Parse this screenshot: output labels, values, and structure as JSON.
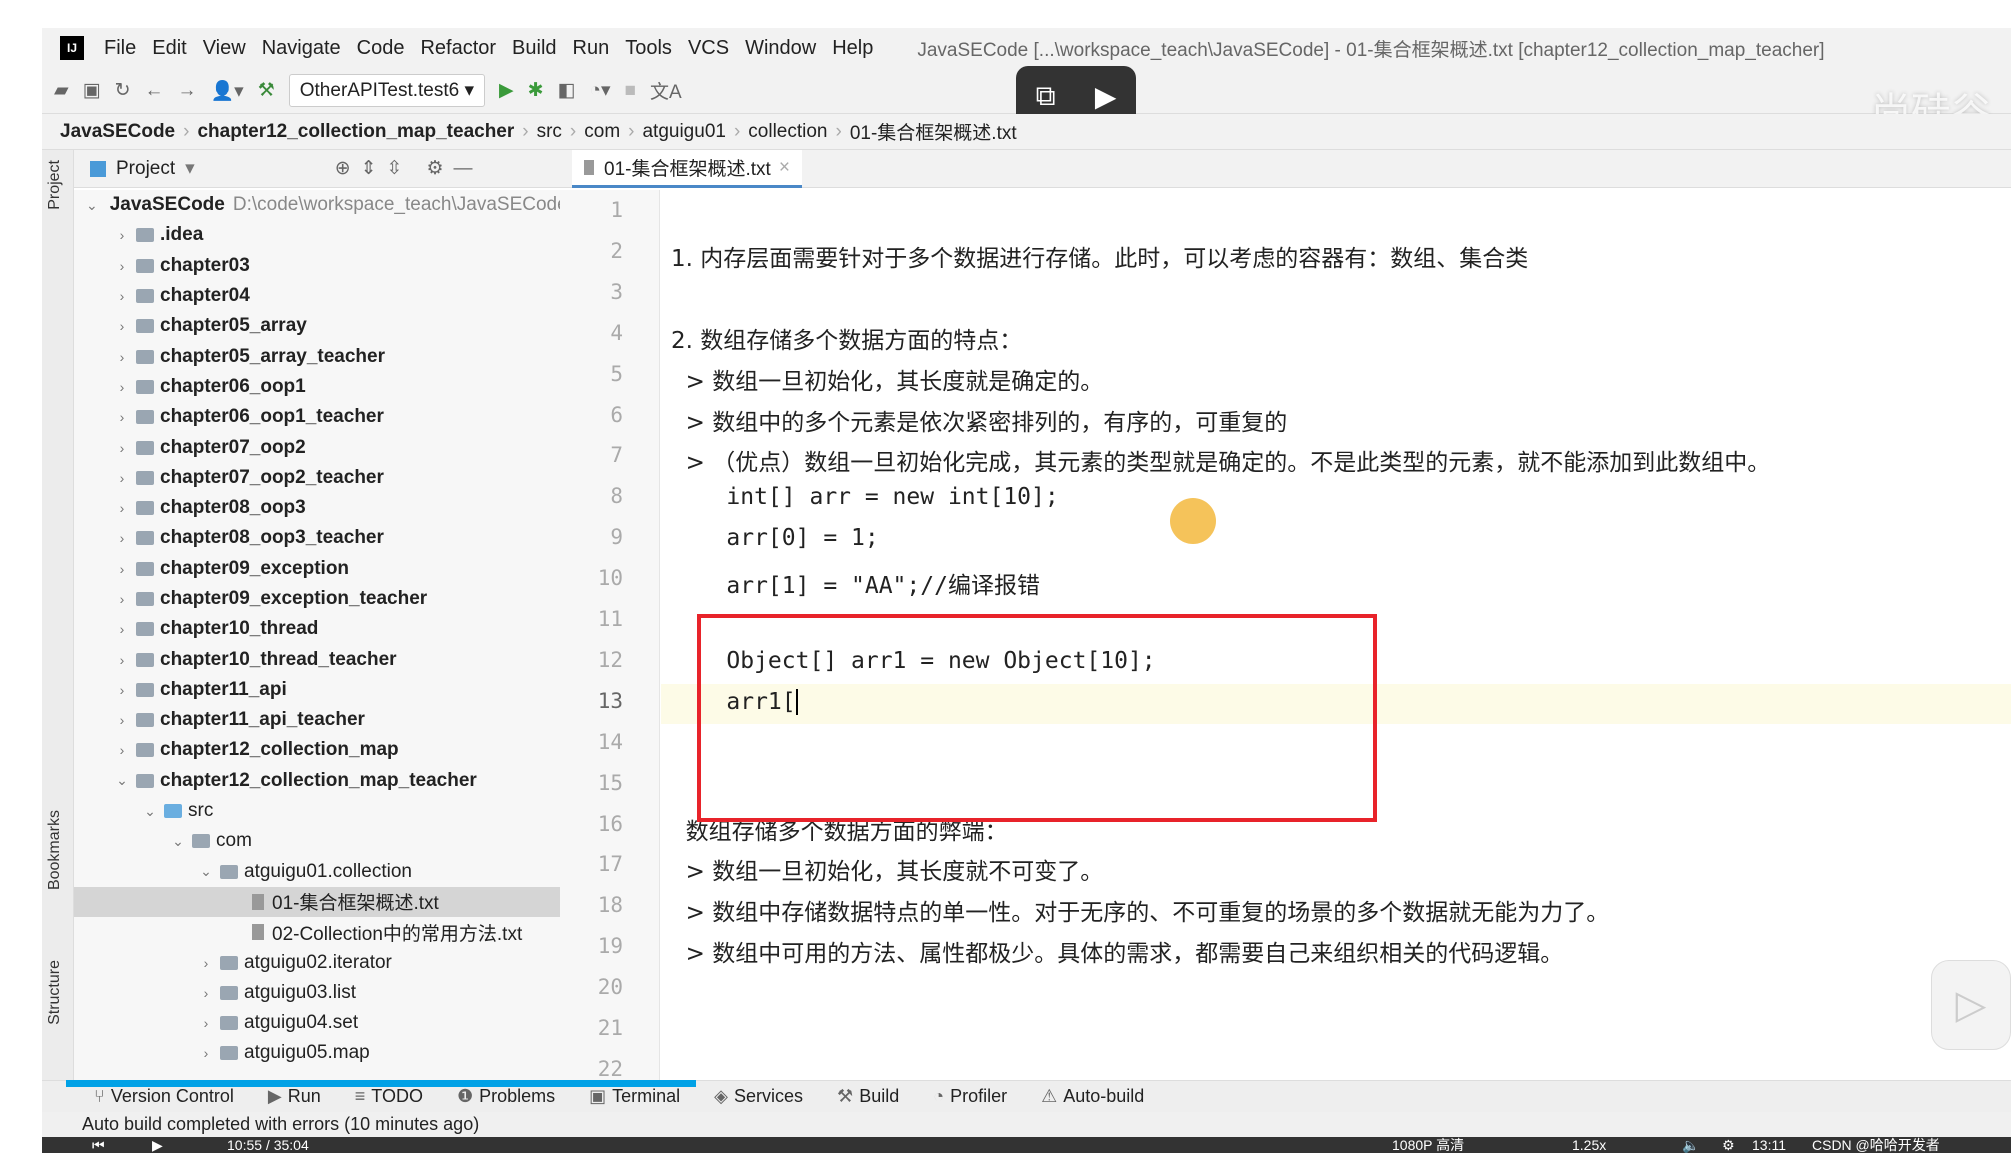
{
  "menu": {
    "items": [
      "File",
      "Edit",
      "View",
      "Navigate",
      "Code",
      "Refactor",
      "Build",
      "Run",
      "Tools",
      "VCS",
      "Window",
      "Help"
    ],
    "title": "JavaSECode [...\\workspace_teach\\JavaSECode] - 01-集合框架概述.txt [chapter12_collection_map_teacher]"
  },
  "toolbar": {
    "run_config": "OtherAPITest.test6"
  },
  "breadcrumb": [
    "JavaSECode",
    "chapter12_collection_map_teacher",
    "src",
    "com",
    "atguigu01",
    "collection",
    "01-集合框架概述.txt"
  ],
  "sidebar": {
    "project": "Project",
    "bookmarks": "Bookmarks",
    "structure": "Structure"
  },
  "project": {
    "header": "Project",
    "root": "JavaSECode",
    "root_path": "D:\\code\\workspace_teach\\JavaSECode",
    "items": [
      ".idea",
      "chapter03",
      "chapter04",
      "chapter05_array",
      "chapter05_array_teacher",
      "chapter06_oop1",
      "chapter06_oop1_teacher",
      "chapter07_oop2",
      "chapter07_oop2_teacher",
      "chapter08_oop3",
      "chapter08_oop3_teacher",
      "chapter09_exception",
      "chapter09_exception_teacher",
      "chapter10_thread",
      "chapter10_thread_teacher",
      "chapter11_api",
      "chapter11_api_teacher",
      "chapter12_collection_map",
      "chapter12_collection_map_teacher",
      "src",
      "com",
      "atguigu01.collection",
      "01-集合框架概述.txt",
      "02-Collection中的常用方法.txt",
      "atguigu02.iterator",
      "atguigu03.list",
      "atguigu04.set",
      "atguigu05.map"
    ]
  },
  "editor": {
    "tab": "01-集合框架概述.txt",
    "lines": [
      "",
      "1. 内存层面需要针对于多个数据进行存储。此时，可以考虑的容器有：数组、集合类",
      "",
      "2. 数组存储多个数据方面的特点：",
      "  > 数组一旦初始化，其长度就是确定的。",
      "  > 数组中的多个元素是依次紧密排列的，有序的，可重复的",
      "  > （优点）数组一旦初始化完成，其元素的类型就是确定的。不是此类型的元素，就不能添加到此数组中。",
      "    int[] arr = new int[10];",
      "    arr[0] = 1;",
      "    arr[1] = \"AA\";//编译报错",
      "",
      "    Object[] arr1 = new Object[10];",
      "    arr1[",
      "",
      "",
      "  数组存储多个数据方面的弊端：",
      "  > 数组一旦初始化，其长度就不可变了。",
      "  > 数组中存储数据特点的单一性。对于无序的、不可重复的场景的多个数据就无能为力了。",
      "  > 数组中可用的方法、属性都极少。具体的需求，都需要自己来组织相关的代码逻辑。",
      "",
      "",
      ""
    ],
    "current_line": 13
  },
  "tools": [
    "Version Control",
    "Run",
    "TODO",
    "Problems",
    "Terminal",
    "Services",
    "Build",
    "Profiler",
    "Auto-build"
  ],
  "status": "Auto build completed with errors (10 minutes ago)",
  "video": {
    "time": "10:55 / 35:04",
    "quality": "1080P 高清",
    "speed": "1.25x",
    "clock": "13:11",
    "watermark": "尚硅谷",
    "credit": "CSDN @哈哈开发者"
  }
}
